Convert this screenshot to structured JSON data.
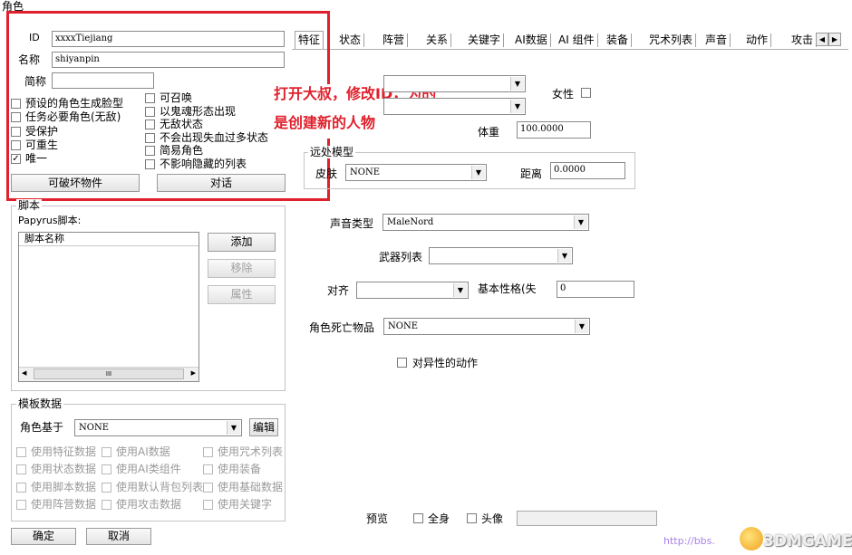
{
  "window": {
    "title": "角色"
  },
  "tabs": [
    "特征",
    "状态",
    "阵营",
    "关系",
    "关键字",
    "AI数据",
    "AI 组件",
    "装备",
    "咒术列表",
    "声音",
    "动作",
    "攻击"
  ],
  "tab_scroll": {
    "left": "◀",
    "right": "▶"
  },
  "identity": {
    "id_label": "ID",
    "id_value": "xxxxTiejiang",
    "name_label": "名称",
    "name_value": "shiyanpin",
    "short_label": "简称",
    "short_value": ""
  },
  "flags_left": [
    {
      "label": "预设的角色生成脸型",
      "checked": false
    },
    {
      "label": "任务必要角色(无敌)",
      "checked": false
    },
    {
      "label": "受保护",
      "checked": false
    },
    {
      "label": "可重生",
      "checked": false
    },
    {
      "label": "唯一",
      "checked": true
    }
  ],
  "flags_right": [
    {
      "label": "可召唤",
      "checked": false
    },
    {
      "label": "以鬼魂形态出现",
      "checked": false
    },
    {
      "label": "无敌状态",
      "checked": false
    },
    {
      "label": "不会出现失血过多状态",
      "checked": false
    },
    {
      "label": "简易角色",
      "checked": false
    },
    {
      "label": "不影响隐藏的列表",
      "checked": false
    }
  ],
  "check_mark": "✓",
  "buttons": {
    "destructible": "可破坏物件",
    "dialogue": "对话",
    "ok": "确定",
    "cancel": "取消",
    "edit": "编辑"
  },
  "script": {
    "group_title": "脚本",
    "papyrus_label": "Papyrus脚本:",
    "column_header": "脚本名称",
    "add": "添加",
    "remove": "移除",
    "properties": "属性",
    "scroll_left": "◀",
    "scroll_right": "▶",
    "scroll_thumb": "III"
  },
  "annotation": {
    "line1": "打开大叔，修改ID，为的",
    "line2": "是创建新的人物"
  },
  "traits": {
    "female_label": "女性",
    "weight_label": "体重",
    "weight_value": "100.0000",
    "far_model_title": "远处模型",
    "skin_label": "皮肤",
    "skin_value": "NONE",
    "distance_label": "距离",
    "distance_value": "0.0000",
    "voice_label": "声音类型",
    "voice_value": "MaleNord",
    "weapon_label": "武器列表",
    "weapon_value": "",
    "align_label": "对齐",
    "align_value": "",
    "base_label": "基本性格(失",
    "base_value": "0",
    "death_label": "角色死亡物品",
    "death_value": "NONE",
    "opposite_label": "对异性的动作"
  },
  "template": {
    "group_title": "模板数据",
    "based_on_label": "角色基于",
    "based_on_value": "NONE",
    "options": [
      [
        "使用特征数据",
        "使用AI数据",
        "使用咒术列表"
      ],
      [
        "使用状态数据",
        "使用AI类组件",
        "使用装备"
      ],
      [
        "使用脚本数据",
        "使用默认背包列表",
        "使用基础数据"
      ],
      [
        "使用阵营数据",
        "使用攻击数据",
        "使用关键字"
      ]
    ]
  },
  "preview": {
    "label": "预览",
    "full_body": "全身",
    "head": "头像"
  },
  "watermark": {
    "url": "http://bbs.",
    "brand": "3DMGAME"
  },
  "colors": {
    "highlight_box": "#e0202c",
    "annotation_text": "#e0202c"
  }
}
